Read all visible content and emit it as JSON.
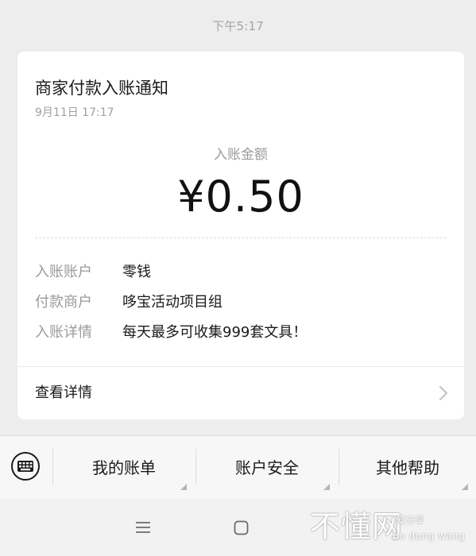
{
  "chat": {
    "timestamp": "下午5:17"
  },
  "card": {
    "title": "商家付款入账通知",
    "date": "9月11日  17:17",
    "amount_label": "入账金额",
    "amount_value": "¥0.50",
    "rows": [
      {
        "label": "入账账户",
        "value": "零钱"
      },
      {
        "label": "付款商户",
        "value": "哆宝活动项目组"
      },
      {
        "label": "入账详情",
        "value": "每天最多可收集999套文具！"
      }
    ],
    "view_details": "查看详情"
  },
  "menu": {
    "items": [
      {
        "label": "我的账单"
      },
      {
        "label": "账户安全"
      },
      {
        "label": "其他帮助"
      }
    ]
  },
  "watermark": {
    "main": "不懂网",
    "sub1": "爱分享",
    "sub2": "bu dong wang"
  },
  "icons": {
    "keyboard": "keyboard-icon",
    "chevron": "chevron-right-icon",
    "nav_menu": "menu-icon",
    "nav_home": "home-icon"
  },
  "colors": {
    "background": "#ededed",
    "card": "#ffffff",
    "muted_text": "#9a9a9a",
    "primary_text": "#1a1a1a"
  }
}
